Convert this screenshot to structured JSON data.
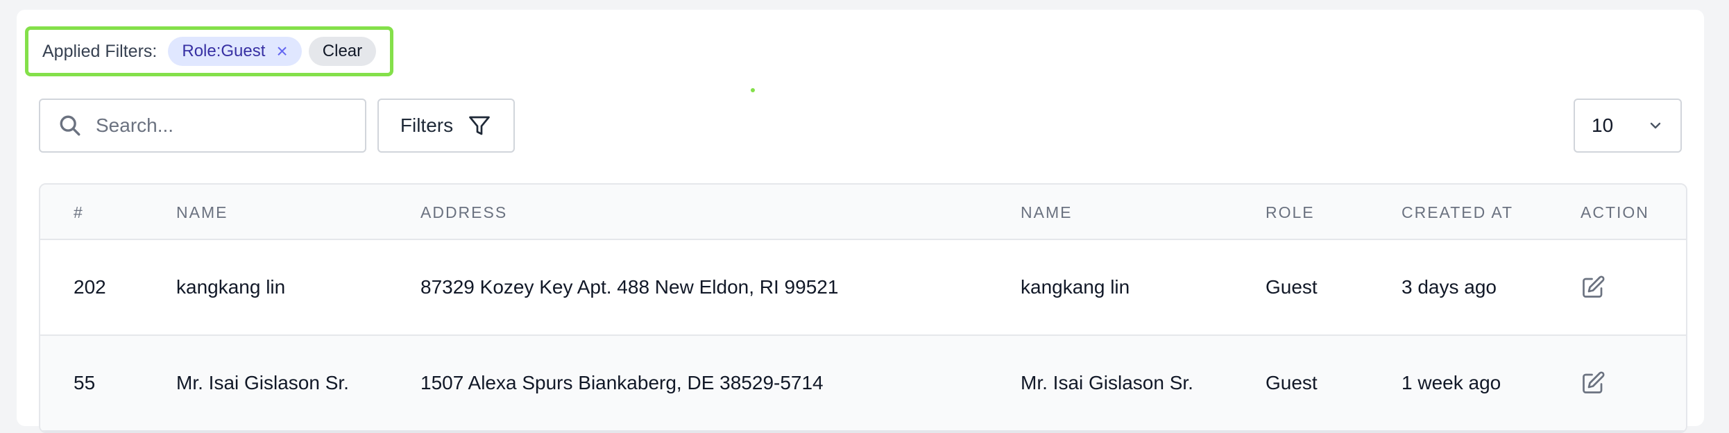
{
  "filters": {
    "label": "Applied Filters:",
    "chips": [
      {
        "label": "Role:Guest",
        "close_icon": "×"
      }
    ],
    "clear_label": "Clear"
  },
  "colors": {
    "highlight": "#84e04a",
    "chip_bg": "#e0e7ff",
    "chip_text": "#3730a3"
  },
  "search": {
    "placeholder": "Search...",
    "value": "",
    "icon": "search-icon"
  },
  "filters_button": {
    "label": "Filters",
    "icon": "funnel-icon"
  },
  "per_page": {
    "value": "10",
    "icon": "chevron-down-icon"
  },
  "table": {
    "columns": [
      "#",
      "NAME",
      "ADDRESS",
      "NAME",
      "ROLE",
      "CREATED AT",
      "ACTION"
    ],
    "rows": [
      {
        "id": "202",
        "name": "kangkang lin",
        "address": "87329 Kozey Key Apt. 488 New Eldon, RI 99521",
        "name2": "kangkang lin",
        "role": "Guest",
        "created": "3 days ago",
        "action_icon": "edit-icon"
      },
      {
        "id": "55",
        "name": "Mr. Isai Gislason Sr.",
        "address": "1507 Alexa Spurs Biankaberg, DE 38529-5714",
        "name2": "Mr. Isai Gislason Sr.",
        "role": "Guest",
        "created": "1 week ago",
        "action_icon": "edit-icon"
      }
    ]
  }
}
